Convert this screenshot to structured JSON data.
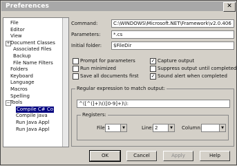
{
  "window": {
    "title": "Preferences",
    "close_glyph": "✕"
  },
  "tree": {
    "items": [
      {
        "label": "File",
        "expander": ""
      },
      {
        "label": "Editor",
        "expander": ""
      },
      {
        "label": "View",
        "expander": ""
      },
      {
        "label": "Document Classes",
        "expander": "+"
      },
      {
        "label": "Associated Files",
        "expander": ""
      },
      {
        "label": "Backup",
        "expander": ""
      },
      {
        "label": "File Name Filters",
        "expander": ""
      },
      {
        "label": "Folders",
        "expander": ""
      },
      {
        "label": "Keyboard",
        "expander": ""
      },
      {
        "label": "Language",
        "expander": ""
      },
      {
        "label": "Macros",
        "expander": ""
      },
      {
        "label": "Spelling",
        "expander": ""
      },
      {
        "label": "Tools",
        "expander": "−"
      },
      {
        "label": "Compile C# Co",
        "expander": ""
      },
      {
        "label": "Compile Java",
        "expander": ""
      },
      {
        "label": "Run Java Appl",
        "expander": ""
      },
      {
        "label": "Run Java Appl",
        "expander": ""
      }
    ],
    "selected_index": 13
  },
  "form": {
    "command_label": "Command:",
    "command_value": "C:\\WINDOWS\\Microsoft.NET\\Framework\\v2.0.406",
    "parameters_label": "Parameters:",
    "parameters_value": "*.cs",
    "initial_folder_label": "Initial folder:",
    "initial_folder_value": "$FileDir",
    "checkboxes": [
      {
        "label": "Prompt for parameters",
        "checked": false
      },
      {
        "label": "Run minimized",
        "checked": false
      },
      {
        "label": "Save all documents first",
        "checked": false
      },
      {
        "label": "Capture output",
        "checked": true
      },
      {
        "label": "Suppress output until completed",
        "checked": false
      },
      {
        "label": "Sound alert when completed",
        "checked": true
      }
    ],
    "check_mark": "✓",
    "regex_group_label": "Regular expression to match output:",
    "regex_value": "^([^(]+)\\(([0-9]+)\\):",
    "registers_label": "Registers:",
    "file_label": "File:",
    "file_value": "1",
    "line_label": "Line:",
    "line_value": "2",
    "column_label": "Column:",
    "column_value": "",
    "dropdown_glyph": "▼"
  },
  "buttons": {
    "ok": "OK",
    "cancel": "Cancel",
    "apply": "Apply",
    "help": "Help"
  }
}
